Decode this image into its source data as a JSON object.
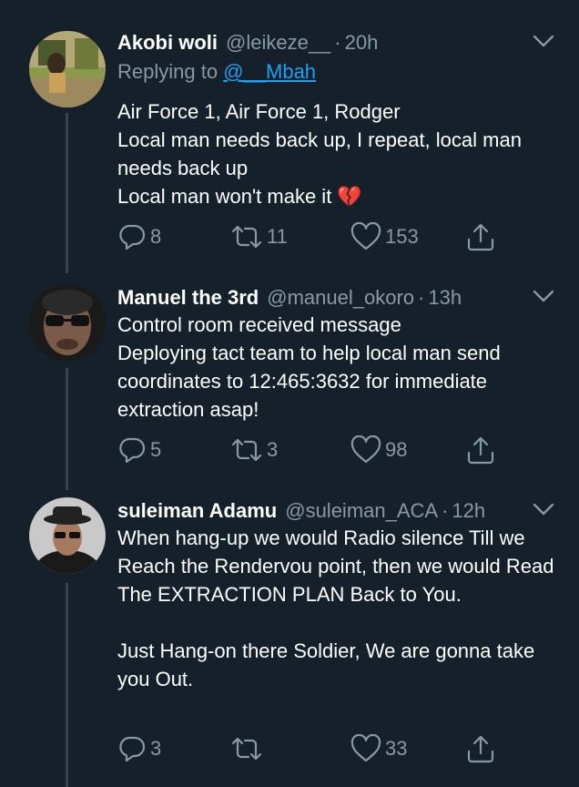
{
  "tweets": [
    {
      "name": "Akobi woli",
      "handle": "@leikeze__",
      "separator": "·",
      "time": "20h",
      "replying_prefix": "Replying to",
      "replying_to": "@__Mbah",
      "lines": [
        "Air Force 1, Air Force 1, Rodger",
        "Local man needs back up,  I repeat,  local man needs back up",
        "Local man won't make it 💔"
      ],
      "replies": "8",
      "retweets": "11",
      "likes": "153"
    },
    {
      "name": "Manuel the 3rd",
      "handle": "@manuel_okoro",
      "separator": "·",
      "time": "13h",
      "lines": [
        "Control room received message",
        "Deploying tact team to help local man send coordinates to 12:465:3632 for immediate extraction asap!"
      ],
      "replies": "5",
      "retweets": "3",
      "likes": "98"
    },
    {
      "name": "suleiman Adamu",
      "handle": "@suleiman_ACA",
      "separator": "·",
      "time": "12h",
      "lines": [
        "When hang-up we would Radio silence Till we Reach the Rendervou point, then we would Read The EXTRACTION PLAN Back to You.",
        "",
        "Just Hang-on there Soldier, We are gonna take you Out."
      ],
      "replies": "3",
      "retweets": "",
      "likes": "33"
    }
  ],
  "icons": {
    "reply": "reply-icon",
    "retweet": "retweet-icon",
    "like": "like-icon",
    "share": "share-icon",
    "more": "chevron-down-icon"
  },
  "colors": {
    "background": "#15202b",
    "text": "#ffffff",
    "secondary": "#8899a6",
    "link": "#1da1f2",
    "thread_line": "#38444d"
  }
}
